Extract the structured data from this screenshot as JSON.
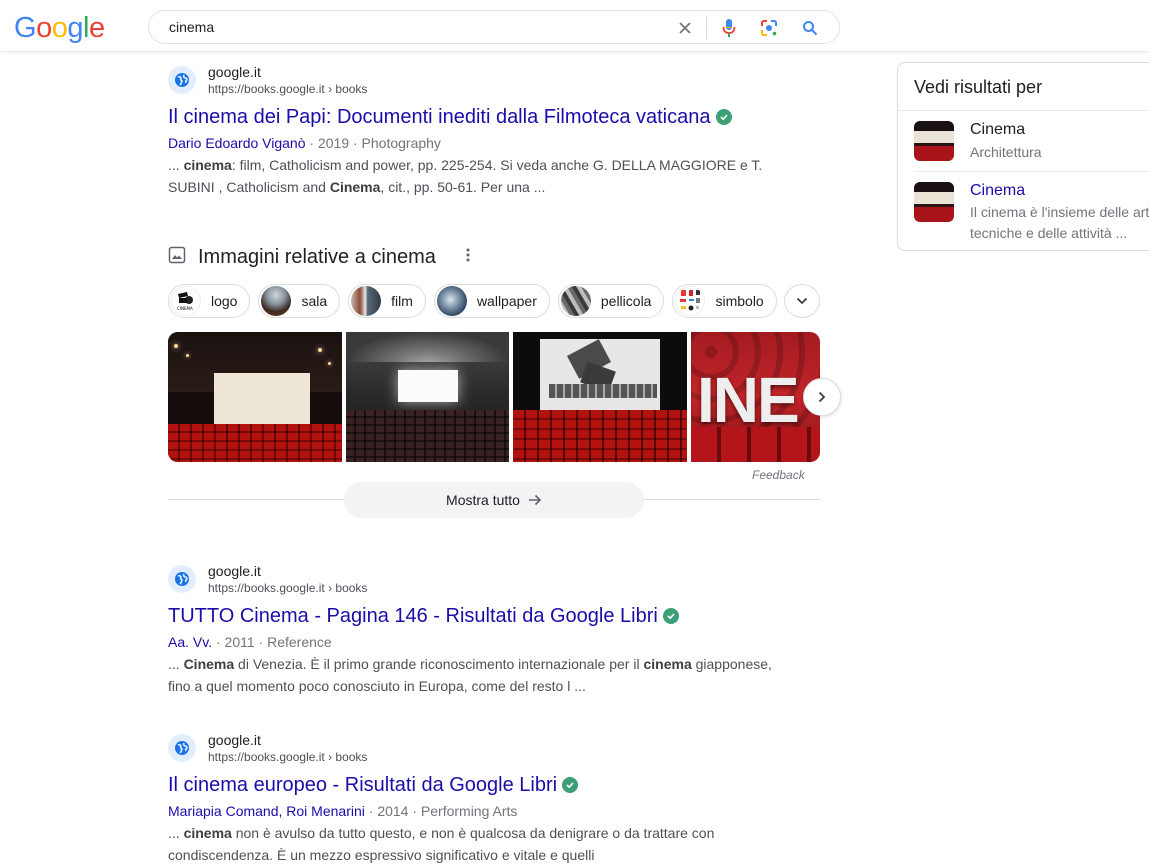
{
  "header": {
    "logo_letters": [
      {
        "ch": "G",
        "color": "#4285f4"
      },
      {
        "ch": "o",
        "color": "#ea4335"
      },
      {
        "ch": "o",
        "color": "#fbbc05"
      },
      {
        "ch": "g",
        "color": "#4285f4"
      },
      {
        "ch": "l",
        "color": "#34a853"
      },
      {
        "ch": "e",
        "color": "#ea4335"
      }
    ],
    "search_value": "cinema",
    "icons": [
      "clear-icon",
      "microphone-icon",
      "google-lens-icon",
      "search-icon"
    ]
  },
  "results": [
    {
      "site_name": "google.it",
      "site_url": "https://books.google.it › books",
      "title": "Il cinema dei Papi: Documenti inediti dalla Filmoteca vaticana",
      "verified": true,
      "author": "Dario Edoardo Viganò",
      "meta_rest": " · 2019 · Photography",
      "snippet_parts": [
        {
          "t": "... ",
          "b": false
        },
        {
          "t": "cinema",
          "b": true
        },
        {
          "t": ": film, Catholicism and power, pp. 225-254. Si veda anche G. DELLA MAGGIORE e T. SUBINI , Catholicism and ",
          "b": false
        },
        {
          "t": "Cinema",
          "b": true
        },
        {
          "t": ", cit., pp. 50-61. Per una ...",
          "b": false
        }
      ]
    },
    {
      "site_name": "google.it",
      "site_url": "https://books.google.it › books",
      "title": "TUTTO Cinema - Pagina 146 - Risultati da Google Libri",
      "verified": true,
      "author": "Aa. Vv.",
      "meta_rest": " · 2011 · Reference",
      "snippet_parts": [
        {
          "t": "... ",
          "b": false
        },
        {
          "t": "Cinema",
          "b": true
        },
        {
          "t": " di Venezia. È il primo grande riconoscimento internazionale per il ",
          "b": false
        },
        {
          "t": "cinema",
          "b": true
        },
        {
          "t": " giapponese, fino a quel momento poco conosciuto in Europa, come del resto l ...",
          "b": false
        }
      ]
    },
    {
      "site_name": "google.it",
      "site_url": "https://books.google.it › books",
      "title": "Il cinema europeo - Risultati da Google Libri",
      "verified": true,
      "author": "Mariapia Comand, Roi Menarini",
      "meta_rest": " · 2014 · Performing Arts",
      "snippet_parts": [
        {
          "t": "... ",
          "b": false
        },
        {
          "t": "cinema",
          "b": true
        },
        {
          "t": " non è avulso da tutto questo, e non è qualcosa da denigrare o da trattare con condiscendenza. È un mezzo espressivo significativo e vitale e quelli",
          "b": false
        }
      ]
    }
  ],
  "images_section": {
    "title": "Immagini relative a cinema",
    "chips": [
      {
        "label": "logo",
        "thumb": "logo"
      },
      {
        "label": "sala",
        "thumb": "sala"
      },
      {
        "label": "film",
        "thumb": "film"
      },
      {
        "label": "wallpaper",
        "thumb": "wallpaper"
      },
      {
        "label": "pellicola",
        "thumb": "pellicola"
      },
      {
        "label": "simbolo",
        "thumb": "simbolo"
      }
    ],
    "images": [
      {
        "alt": "Sala cinema con schermo e poltrone rosse"
      },
      {
        "alt": "Sala cinema scura con schermo bianco"
      },
      {
        "alt": "Schermo con ciak e pellicola, poltrone rosse"
      },
      {
        "alt": "Scritta CINE su poltrone rosse"
      }
    ],
    "feedback": "Feedback",
    "show_all": "Mostra tutto"
  },
  "side_panel": {
    "title": "Vedi risultati per",
    "items": [
      {
        "name": "Cinema",
        "sub": "Architettura",
        "link": false
      },
      {
        "name": "Cinema",
        "sub": "Il cinema è l'insieme delle arti",
        "sub2": "tecniche e delle attività ...",
        "link": true
      }
    ]
  }
}
